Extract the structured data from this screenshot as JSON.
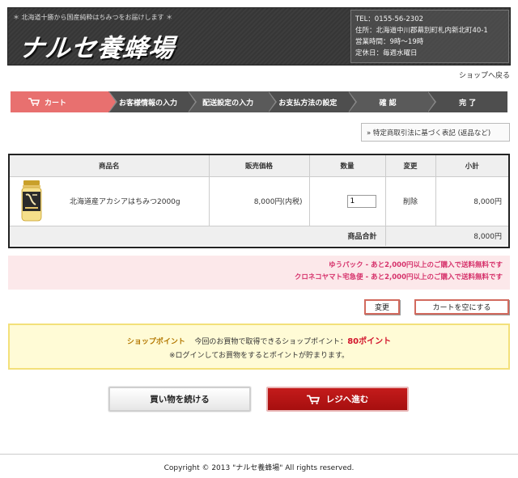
{
  "header": {
    "tagline": "＊ 北海道十勝から国産純粋はちみつをお届けします ＊",
    "logo_text": "ナルセ養蜂場",
    "shop_info": [
      "TEL：0155-56-2302",
      "住所：北海道中川郡幕別町札内新北町40-1",
      "営業時間：9時〜19時",
      "定休日：毎週水曜日"
    ]
  },
  "nav": {
    "back_to_shop": "ショップへ戻る"
  },
  "steps": [
    "カート",
    "お客様情報の入力",
    "配送設定の入力",
    "お支払方法の設定",
    "確 認",
    "完 了"
  ],
  "legal_link": "» 特定商取引法に基づく表記 (返品など)",
  "cart": {
    "headers": [
      "商品名",
      "販売価格",
      "数量",
      "変更",
      "小計"
    ],
    "items": [
      {
        "name": "北海道産アカシアはちみつ2000g",
        "price": "8,000円(内税)",
        "quantity": "1",
        "action": "削除",
        "subtotal": "8,000円"
      }
    ],
    "total_label": "商品合計",
    "total_value": "8,000円"
  },
  "shipping_notices": [
    "ゆうパック - あと2,000円以上のご購入で送料無料です",
    "クロネコヤマト宅急便 - あと2,000円以上のご購入で送料無料です"
  ],
  "buttons": {
    "update": "変更",
    "empty_cart": "カートを空にする",
    "continue_shopping": "買い物を続ける",
    "checkout": "レジへ進む"
  },
  "points": {
    "label": "ショップポイント",
    "text": "今回のお買物で取得できるショップポイント：",
    "value": "80ポイント",
    "note": "※ログインしてお買物をするとポイントが貯まります。"
  },
  "footer": {
    "copyright": "Copyright © 2013 \"ナルセ養蜂場\" All rights reserved."
  },
  "colors": {
    "accent": "#e8706f",
    "checkout": "#b31414",
    "shipping_text": "#d6336c"
  }
}
